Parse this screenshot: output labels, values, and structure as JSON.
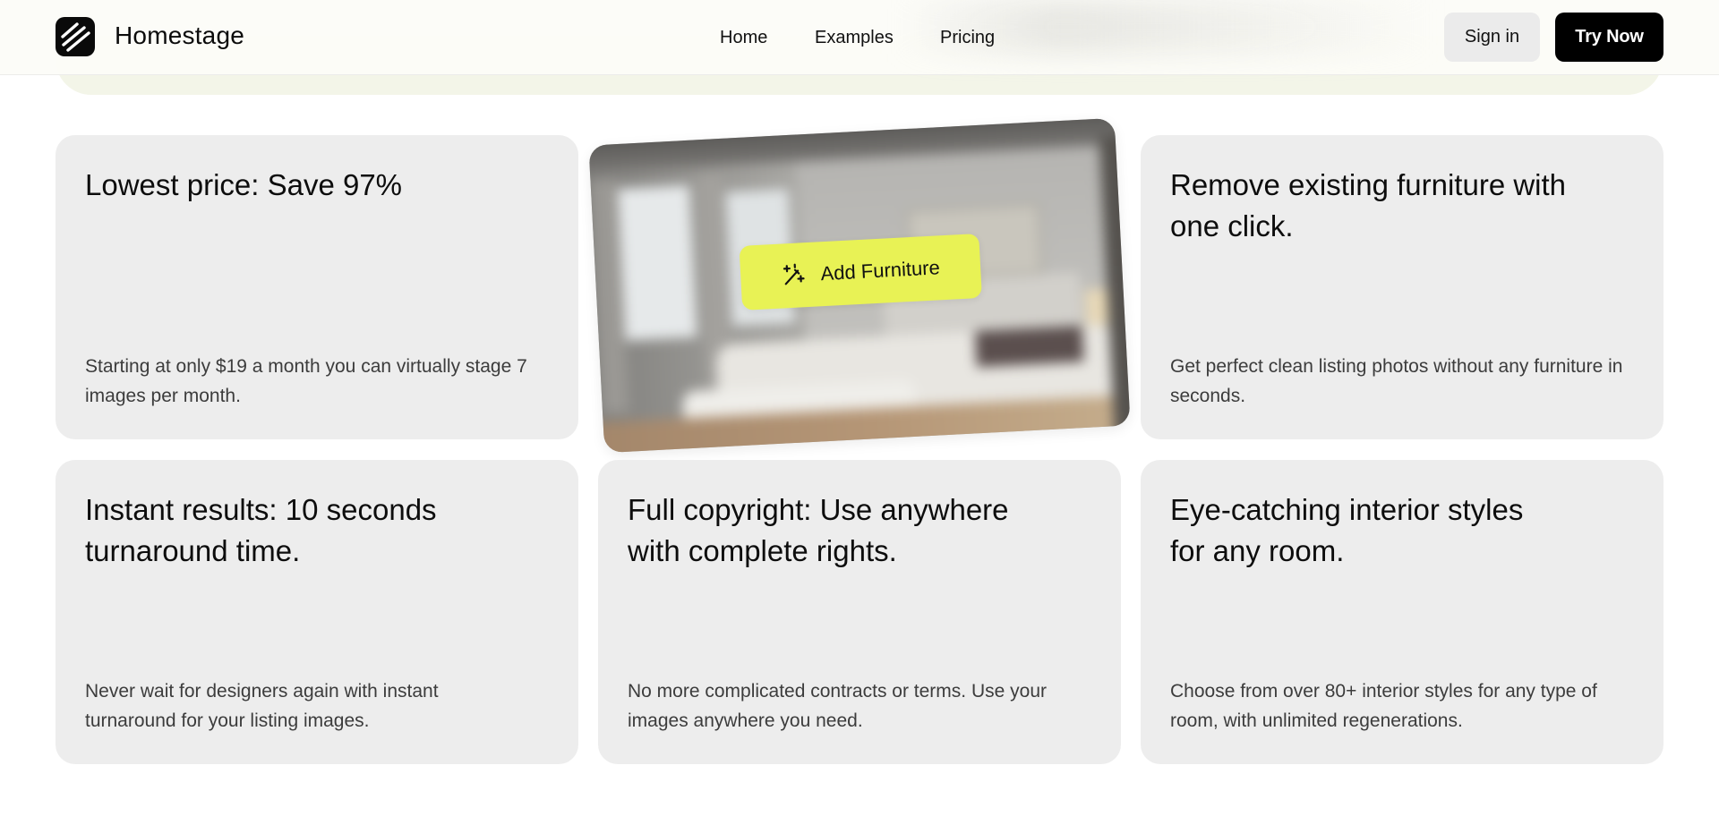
{
  "header": {
    "brand": "Homestage",
    "nav": [
      "Home",
      "Examples",
      "Pricing"
    ],
    "sign_in": "Sign in",
    "try_now": "Try Now"
  },
  "features": [
    {
      "title": "Lowest price: Save 97%",
      "desc": "Starting at only $19 a month you can virtually stage 7 images per month."
    },
    {
      "title": "Remove existing furniture with one click.",
      "desc": "Get perfect clean listing photos without any furniture in seconds."
    },
    {
      "title": "Instant results: 10 seconds turnaround time.",
      "desc": "Never wait for designers again with instant turnaround for your listing images."
    },
    {
      "title": "Full copyright: Use anywhere with complete rights.",
      "desc": "No more complicated contracts or terms. Use your images anywhere you need."
    },
    {
      "title": "Eye-catching interior styles for any room.",
      "desc": "Choose from over 80+ interior styles for any type of room, with unlimited regenerations."
    }
  ],
  "showcase": {
    "button_label": "Add Furniture",
    "button_icon": "magic-wand-icon"
  },
  "colors": {
    "accent": "#e8f255",
    "primary_button": "#000000",
    "card_background": "#ededed"
  }
}
